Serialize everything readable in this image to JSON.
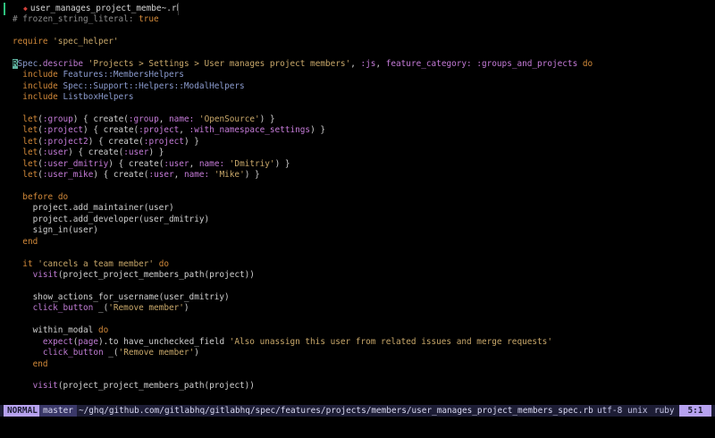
{
  "tab": {
    "filename": "user_manages_project_membe~.rb",
    "icon": "ruby-file-icon"
  },
  "editor": {
    "lines": [
      [
        [
          "cm",
          "# frozen_string_literal: "
        ],
        [
          "bool",
          "true"
        ]
      ],
      [],
      [
        [
          "kw",
          "require "
        ],
        [
          "str",
          "'spec_helper'"
        ]
      ],
      [],
      [
        [
          "cur",
          "R"
        ],
        [
          "con",
          "Spec"
        ],
        [
          "pl",
          "."
        ],
        [
          "mth",
          "describe"
        ],
        [
          "pl",
          " "
        ],
        [
          "str",
          "'Projects > Settings > User manages project members'"
        ],
        [
          "pl",
          ", "
        ],
        [
          "sym",
          ":js"
        ],
        [
          "pl",
          ", "
        ],
        [
          "sym",
          "feature_category: :groups_and_projects"
        ],
        [
          "pl",
          " "
        ],
        [
          "kw",
          "do"
        ]
      ],
      [
        [
          "pl",
          "  "
        ],
        [
          "kw",
          "include "
        ],
        [
          "con",
          "Features::MembersHelpers"
        ]
      ],
      [
        [
          "pl",
          "  "
        ],
        [
          "kw",
          "include "
        ],
        [
          "con",
          "Spec::Support::Helpers::ModalHelpers"
        ]
      ],
      [
        [
          "pl",
          "  "
        ],
        [
          "kw",
          "include "
        ],
        [
          "con",
          "ListboxHelpers"
        ]
      ],
      [],
      [
        [
          "pl",
          "  "
        ],
        [
          "kw",
          "let"
        ],
        [
          "pl",
          "("
        ],
        [
          "sym",
          ":group"
        ],
        [
          "pl",
          ") { create("
        ],
        [
          "sym",
          ":group"
        ],
        [
          "pl",
          ", "
        ],
        [
          "sym",
          "name:"
        ],
        [
          "pl",
          " "
        ],
        [
          "str",
          "'OpenSource'"
        ],
        [
          "pl",
          ") }"
        ]
      ],
      [
        [
          "pl",
          "  "
        ],
        [
          "kw",
          "let"
        ],
        [
          "pl",
          "("
        ],
        [
          "sym",
          ":project"
        ],
        [
          "pl",
          ") { create("
        ],
        [
          "sym",
          ":project"
        ],
        [
          "pl",
          ", "
        ],
        [
          "sym",
          ":with_namespace_settings"
        ],
        [
          "pl",
          ") }"
        ]
      ],
      [
        [
          "pl",
          "  "
        ],
        [
          "kw",
          "let"
        ],
        [
          "pl",
          "("
        ],
        [
          "sym",
          ":project2"
        ],
        [
          "pl",
          ") { create("
        ],
        [
          "sym",
          ":project"
        ],
        [
          "pl",
          ") }"
        ]
      ],
      [
        [
          "pl",
          "  "
        ],
        [
          "kw",
          "let"
        ],
        [
          "pl",
          "("
        ],
        [
          "sym",
          ":user"
        ],
        [
          "pl",
          ") { create("
        ],
        [
          "sym",
          ":user"
        ],
        [
          "pl",
          ") }"
        ]
      ],
      [
        [
          "pl",
          "  "
        ],
        [
          "kw",
          "let"
        ],
        [
          "pl",
          "("
        ],
        [
          "sym",
          ":user_dmitriy"
        ],
        [
          "pl",
          ") { create("
        ],
        [
          "sym",
          ":user"
        ],
        [
          "pl",
          ", "
        ],
        [
          "sym",
          "name:"
        ],
        [
          "pl",
          " "
        ],
        [
          "str",
          "'Dmitriy'"
        ],
        [
          "pl",
          ") }"
        ]
      ],
      [
        [
          "pl",
          "  "
        ],
        [
          "kw",
          "let"
        ],
        [
          "pl",
          "("
        ],
        [
          "sym",
          ":user_mike"
        ],
        [
          "pl",
          ") { create("
        ],
        [
          "sym",
          ":user"
        ],
        [
          "pl",
          ", "
        ],
        [
          "sym",
          "name:"
        ],
        [
          "pl",
          " "
        ],
        [
          "str",
          "'Mike'"
        ],
        [
          "pl",
          ") }"
        ]
      ],
      [],
      [
        [
          "pl",
          "  "
        ],
        [
          "kw",
          "before "
        ],
        [
          "kw",
          "do"
        ]
      ],
      [
        [
          "pl",
          "    project.add_maintainer(user)"
        ]
      ],
      [
        [
          "pl",
          "    project.add_developer(user_dmitriy)"
        ]
      ],
      [
        [
          "pl",
          "    sign_in(user)"
        ]
      ],
      [
        [
          "pl",
          "  "
        ],
        [
          "kw",
          "end"
        ]
      ],
      [],
      [
        [
          "pl",
          "  "
        ],
        [
          "kw",
          "it "
        ],
        [
          "str",
          "'cancels a team member'"
        ],
        [
          "pl",
          " "
        ],
        [
          "kw",
          "do"
        ]
      ],
      [
        [
          "pl",
          "    "
        ],
        [
          "mth",
          "visit"
        ],
        [
          "pl",
          "(project_project_members_path(project))"
        ]
      ],
      [],
      [
        [
          "pl",
          "    show_actions_for_username(user_dmitriy)"
        ]
      ],
      [
        [
          "pl",
          "    "
        ],
        [
          "mth",
          "click_button"
        ],
        [
          "pl",
          " _("
        ],
        [
          "str",
          "'Remove member'"
        ],
        [
          "pl",
          ")"
        ]
      ],
      [],
      [
        [
          "pl",
          "    within_modal "
        ],
        [
          "kw",
          "do"
        ]
      ],
      [
        [
          "pl",
          "      "
        ],
        [
          "mth",
          "expect"
        ],
        [
          "pl",
          "("
        ],
        [
          "mth",
          "page"
        ],
        [
          "pl",
          ").to have_unchecked_field "
        ],
        [
          "str",
          "'Also unassign this user from related issues and merge requests'"
        ]
      ],
      [
        [
          "pl",
          "      "
        ],
        [
          "mth",
          "click_button"
        ],
        [
          "pl",
          " _("
        ],
        [
          "str",
          "'Remove member'"
        ],
        [
          "pl",
          ")"
        ]
      ],
      [
        [
          "pl",
          "    "
        ],
        [
          "kw",
          "end"
        ]
      ],
      [],
      [
        [
          "pl",
          "    "
        ],
        [
          "mth",
          "visit"
        ],
        [
          "pl",
          "(project_project_members_path(project))"
        ]
      ]
    ]
  },
  "statusline": {
    "mode": "NORMAL",
    "branch": "master",
    "path": "~/ghq/github.com/gitlabhq/gitlabhq/spec/features/projects/members/user_manages_project_members_spec.rb",
    "encoding": "utf-8",
    "fileformat": "unix",
    "filetype": "ruby",
    "position": "5:1"
  },
  "colors": {
    "background": "#000000",
    "mode_bg": "#b7a2f0",
    "statusline_bg": "#1d1d35",
    "keyword": "#d38a3a",
    "string": "#c9a86a",
    "symbol": "#c57bd8",
    "constant": "#8c9ccf"
  }
}
